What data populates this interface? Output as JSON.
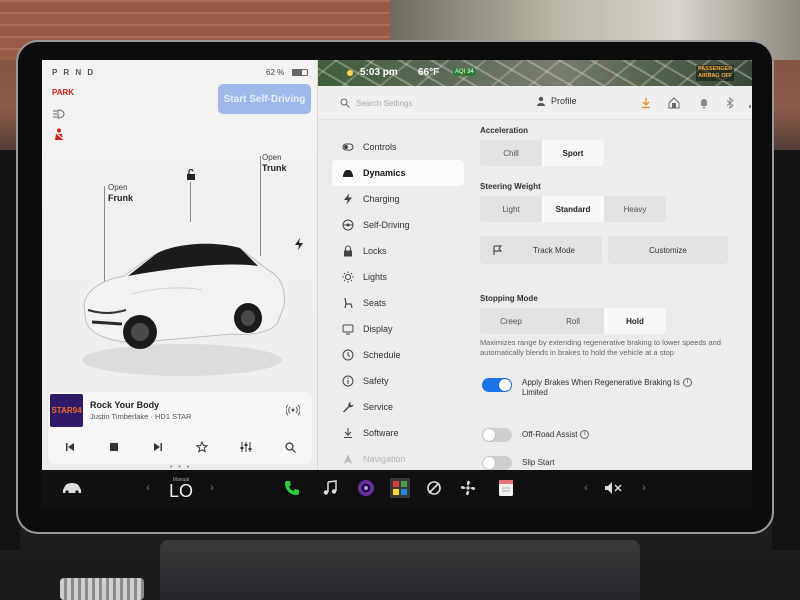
{
  "status": {
    "gears": "P R N D",
    "battery_percent": "62 %",
    "battery_level": 0.62,
    "park_label": "PARK",
    "time": "5:03 pm",
    "temperature": "66°F",
    "aqi": "AQI 34",
    "airbag_line1": "PASSENGER",
    "airbag_line2": "AIRBAG OFF"
  },
  "car_panel": {
    "start_button": "Start Self-Driving",
    "frunk_line1": "Open",
    "frunk_line2": "Frunk",
    "trunk_line1": "Open",
    "trunk_line2": "Trunk"
  },
  "media": {
    "album_text": "STAR94",
    "song": "Rock Your Body",
    "artist": "Justin Timberlake · HD1 STAR"
  },
  "toprow": {
    "search_placeholder": "Search Settings",
    "profile_label": "Profile"
  },
  "nav": {
    "items": [
      {
        "label": "Controls",
        "icon": "toggle-icon"
      },
      {
        "label": "Dynamics",
        "icon": "car-icon"
      },
      {
        "label": "Charging",
        "icon": "bolt-icon"
      },
      {
        "label": "Self-Driving",
        "icon": "steering-wheel-icon"
      },
      {
        "label": "Locks",
        "icon": "lock-icon"
      },
      {
        "label": "Lights",
        "icon": "sun-icon"
      },
      {
        "label": "Seats",
        "icon": "seat-icon"
      },
      {
        "label": "Display",
        "icon": "display-icon"
      },
      {
        "label": "Schedule",
        "icon": "clock-icon"
      },
      {
        "label": "Safety",
        "icon": "info-icon"
      },
      {
        "label": "Service",
        "icon": "wrench-icon"
      },
      {
        "label": "Software",
        "icon": "download-icon"
      },
      {
        "label": "Navigation",
        "icon": "navigation-icon"
      }
    ]
  },
  "dynamics": {
    "acceleration_label": "Acceleration",
    "acceleration_options": [
      "Chill",
      "Sport"
    ],
    "acceleration_selected": "Sport",
    "steering_label": "Steering Weight",
    "steering_options": [
      "Light",
      "Standard",
      "Heavy"
    ],
    "steering_selected": "Standard",
    "track_mode": "Track Mode",
    "customize": "Customize",
    "stopping_label": "Stopping Mode",
    "stopping_options": [
      "Creep",
      "Roll",
      "Hold"
    ],
    "stopping_selected": "Hold",
    "stopping_desc": "Maximizes range by extending regenerative braking to lower speeds and automatically blends in brakes to hold the vehicle at a stop",
    "apply_brakes_line1": "Apply Brakes When Regenerative Braking Is",
    "apply_brakes_line2": "Limited",
    "apply_brakes_on": true,
    "offroad_label": "Off-Road Assist",
    "offroad_on": false,
    "slip_label": "Slip Start",
    "slip_on": false
  },
  "dock": {
    "climate_mode": "Manual",
    "climate_temp": "LO",
    "page_dots": "• • •"
  },
  "colors": {
    "accent_blue": "#1a73e8",
    "start_button_bg": "#9eb8e8",
    "park_red": "#d3221c",
    "phone_green": "#2ecc40"
  }
}
